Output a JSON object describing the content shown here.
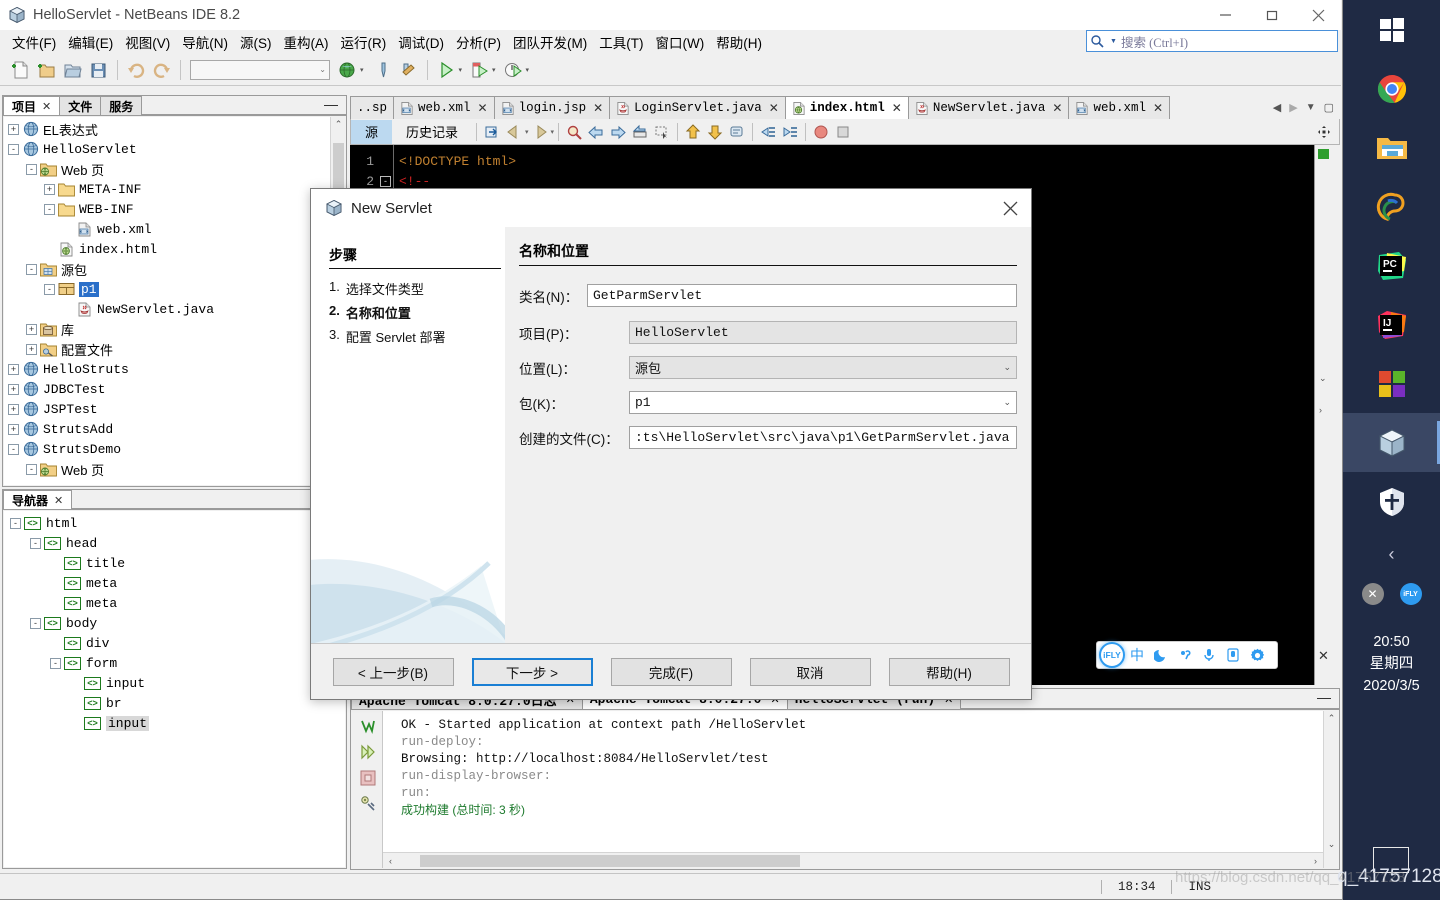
{
  "window": {
    "title": "HelloServlet - NetBeans IDE 8.2",
    "icon": "netbeans-cube-icon",
    "minimize": "minimize-icon",
    "maximize": "maximize-icon",
    "close": "close-icon"
  },
  "menubar": {
    "items": [
      "文件(F)",
      "编辑(E)",
      "视图(V)",
      "导航(N)",
      "源(S)",
      "重构(A)",
      "运行(R)",
      "调试(D)",
      "分析(P)",
      "团队开发(M)",
      "工具(T)",
      "窗口(W)",
      "帮助(H)"
    ]
  },
  "search": {
    "placeholder": "搜索 (Ctrl+I)",
    "value": "",
    "icon": "search-icon"
  },
  "toolbar": {
    "icons": [
      "new-file-icon",
      "new-project-icon",
      "open-project-icon",
      "save-all-icon",
      "undo-icon",
      "redo-icon"
    ],
    "combo_value": "",
    "run_icons": [
      "browser-icon",
      "build-icon",
      "clean-build-icon",
      "run-icon",
      "debug-icon",
      "profile-icon"
    ]
  },
  "left_panel": {
    "tabs": [
      {
        "label": "项目",
        "closable": true,
        "active": true
      },
      {
        "label": "文件",
        "closable": false,
        "active": false
      },
      {
        "label": "服务",
        "closable": false,
        "active": false
      }
    ],
    "minimize_label": "minimize-panel-icon",
    "tree": [
      {
        "indent": 0,
        "expander": "+",
        "icon": "project-globe-icon",
        "label": "EL表达式",
        "cjk": true,
        "selected": "none"
      },
      {
        "indent": 0,
        "expander": "-",
        "icon": "project-globe-icon",
        "label": "HelloServlet",
        "cjk": false,
        "selected": "none"
      },
      {
        "indent": 1,
        "expander": "-",
        "icon": "web-pages-icon",
        "label": "Web 页",
        "cjk": true,
        "selected": "none"
      },
      {
        "indent": 2,
        "expander": "+",
        "icon": "folder-icon",
        "label": "META-INF",
        "cjk": false,
        "selected": "none"
      },
      {
        "indent": 2,
        "expander": "-",
        "icon": "folder-icon",
        "label": "WEB-INF",
        "cjk": false,
        "selected": "none"
      },
      {
        "indent": 3,
        "expander": "",
        "icon": "xml-file-icon",
        "label": "web.xml",
        "cjk": false,
        "selected": "none"
      },
      {
        "indent": 2,
        "expander": "",
        "icon": "html-file-icon",
        "label": "index.html",
        "cjk": false,
        "selected": "none"
      },
      {
        "indent": 1,
        "expander": "-",
        "icon": "source-packages-icon",
        "label": "源包",
        "cjk": true,
        "selected": "none"
      },
      {
        "indent": 2,
        "expander": "-",
        "icon": "package-icon",
        "label": "p1",
        "cjk": false,
        "selected": "blue"
      },
      {
        "indent": 3,
        "expander": "",
        "icon": "java-file-icon",
        "label": "NewServlet.java",
        "cjk": false,
        "selected": "none"
      },
      {
        "indent": 1,
        "expander": "+",
        "icon": "libraries-icon",
        "label": "库",
        "cjk": true,
        "selected": "none"
      },
      {
        "indent": 1,
        "expander": "+",
        "icon": "config-files-icon",
        "label": "配置文件",
        "cjk": true,
        "selected": "none"
      },
      {
        "indent": 0,
        "expander": "+",
        "icon": "project-globe-icon",
        "label": "HelloStruts",
        "cjk": false,
        "selected": "none"
      },
      {
        "indent": 0,
        "expander": "+",
        "icon": "project-globe-icon",
        "label": "JDBCTest",
        "cjk": false,
        "selected": "none"
      },
      {
        "indent": 0,
        "expander": "+",
        "icon": "project-globe-icon",
        "label": "JSPTest",
        "cjk": false,
        "selected": "none"
      },
      {
        "indent": 0,
        "expander": "+",
        "icon": "project-globe-icon",
        "label": "StrutsAdd",
        "cjk": false,
        "selected": "none"
      },
      {
        "indent": 0,
        "expander": "-",
        "icon": "project-globe-icon",
        "label": "StrutsDemo",
        "cjk": false,
        "selected": "none"
      },
      {
        "indent": 1,
        "expander": "-",
        "icon": "web-pages-icon",
        "label": "Web 页",
        "cjk": true,
        "selected": "none"
      }
    ]
  },
  "navigator": {
    "tab_label": "导航器",
    "tree": [
      {
        "indent": 0,
        "expander": "-",
        "label": "html",
        "selected": false
      },
      {
        "indent": 1,
        "expander": "-",
        "label": "head",
        "selected": false
      },
      {
        "indent": 2,
        "expander": "",
        "label": "title",
        "selected": false
      },
      {
        "indent": 2,
        "expander": "",
        "label": "meta",
        "selected": false
      },
      {
        "indent": 2,
        "expander": "",
        "label": "meta",
        "selected": false
      },
      {
        "indent": 1,
        "expander": "-",
        "label": "body",
        "selected": false
      },
      {
        "indent": 2,
        "expander": "",
        "label": "div",
        "selected": false
      },
      {
        "indent": 2,
        "expander": "-",
        "label": "form",
        "selected": false
      },
      {
        "indent": 3,
        "expander": "",
        "label": "input",
        "selected": false
      },
      {
        "indent": 3,
        "expander": "",
        "label": "br",
        "selected": false
      },
      {
        "indent": 3,
        "expander": "",
        "label": "input",
        "selected": true
      }
    ]
  },
  "editor": {
    "tabs": [
      {
        "label": "..sp",
        "icon": "jsp-file-icon",
        "active": false,
        "closable": false,
        "truncated": true
      },
      {
        "label": "web.xml",
        "icon": "xml-file-icon",
        "active": false,
        "closable": true
      },
      {
        "label": "login.jsp",
        "icon": "jsp-file-icon",
        "active": false,
        "closable": true
      },
      {
        "label": "LoginServlet.java",
        "icon": "java-file-icon",
        "active": false,
        "closable": true
      },
      {
        "label": "index.html",
        "icon": "html-file-icon",
        "active": true,
        "closable": true
      },
      {
        "label": "NewServlet.java",
        "icon": "java-file-icon",
        "active": false,
        "closable": true
      },
      {
        "label": "web.xml",
        "icon": "xml-file-icon",
        "active": false,
        "closable": true
      }
    ],
    "tab_nav": [
      "scroll-left-icon",
      "scroll-right-icon",
      "tab-list-icon",
      "maximize-editor-icon"
    ],
    "toolbar": {
      "source_label": "源",
      "history_label": "历史记录",
      "icons": [
        "refresh-icon",
        "back-icon",
        "forward-icon",
        "find-icon",
        "prev-match-icon",
        "next-match-icon",
        "toggle-rect-icon",
        "select-rect-icon",
        "shift-up-icon",
        "shift-down-icon",
        "comment-icon",
        "shift-left-icon",
        "shift-right-icon",
        "record-macro-icon",
        "stop-macro-icon"
      ],
      "right_icon": "expand-all-icon"
    },
    "code_lines": [
      {
        "num": "1",
        "fold": "",
        "text": "<!DOCTYPE html>",
        "color": "#c08030"
      },
      {
        "num": "2",
        "fold": "-",
        "text": "<!--",
        "color": "#cc2222"
      }
    ]
  },
  "output": {
    "tabs": [
      {
        "label": "Apache Tomcat 8.0.27.0日志",
        "active": false,
        "closable": true
      },
      {
        "label": "Apache Tomcat 8.0.27.0",
        "active": true,
        "closable": true
      },
      {
        "label": "HelloServlet (run)",
        "active": false,
        "closable": true
      }
    ],
    "gutter_icons": [
      "rerun-icon",
      "run-again-icon",
      "stop-icon",
      "settings-icon"
    ],
    "lines": [
      {
        "text": "OK - Started application at context path /HelloServlet",
        "style": "ok"
      },
      {
        "text": "run-deploy:",
        "style": "dim"
      },
      {
        "text": "Browsing: http://localhost:8084/HelloServlet/test",
        "style": "ok"
      },
      {
        "text": "run-display-browser:",
        "style": "dim"
      },
      {
        "text": "run:",
        "style": "dim"
      },
      {
        "text": "成功构建 (总时间: 3 秒)",
        "style": "green"
      }
    ]
  },
  "statusbar": {
    "time": "18:34",
    "insert_mode": "INS"
  },
  "dialog": {
    "title": "New Servlet",
    "icon": "netbeans-cube-icon",
    "close_icon": "close-icon",
    "steps_heading": "步骤",
    "steps": [
      {
        "num": "1.",
        "label": "选择文件类型",
        "current": false
      },
      {
        "num": "2.",
        "label": "名称和位置",
        "current": true
      },
      {
        "num": "3.",
        "label": "配置 Servlet 部署",
        "current": false
      }
    ],
    "section_title": "名称和位置",
    "fields": [
      {
        "label": "类名(N)：",
        "value": "GetParmServlet",
        "type": "text",
        "readonly": false
      },
      {
        "label": "项目(P)：",
        "value": "HelloServlet",
        "type": "text",
        "readonly": true
      },
      {
        "label": "位置(L)：",
        "value": "源包",
        "type": "combo",
        "readonly": true
      },
      {
        "label": "包(K)：",
        "value": "p1",
        "type": "combo",
        "readonly": false
      },
      {
        "label": "创建的文件(C)：",
        "value": ":ts\\HelloServlet\\src\\java\\p1\\GetParmServlet.java",
        "type": "text",
        "readonly": false
      }
    ],
    "buttons": [
      {
        "label": "< 上一步(B)",
        "default": false
      },
      {
        "label": "下一步 >",
        "default": true
      },
      {
        "label": "完成(F)",
        "default": false
      },
      {
        "label": "取消",
        "default": false
      },
      {
        "label": "帮助(H)",
        "default": false
      }
    ]
  },
  "ime": {
    "logo": "iFLY",
    "buttons": [
      "chinese-mode-icon",
      "moon-icon",
      "punctuation-icon",
      "microphone-icon",
      "handwriting-icon",
      "settings-gear-icon"
    ],
    "labels": [
      "中",
      "moon",
      "punct",
      "mic",
      "pad",
      "gear"
    ],
    "close_icon": "close-icon"
  },
  "taskbar": {
    "items": [
      {
        "name": "windows-start-icon",
        "active": false
      },
      {
        "name": "chrome-icon",
        "active": false
      },
      {
        "name": "file-explorer-icon",
        "active": false
      },
      {
        "name": "tim-icon",
        "active": false
      },
      {
        "name": "pycharm-icon",
        "active": false
      },
      {
        "name": "intellij-idea-icon",
        "active": false
      },
      {
        "name": "microsoft-store-icon",
        "active": false
      },
      {
        "name": "netbeans-icon",
        "active": true
      },
      {
        "name": "windows-defender-icon",
        "active": false
      }
    ],
    "chevron": "show-hidden-icons-chevron",
    "tray": [
      "close-tray-icon",
      "ifly-tray-icon"
    ],
    "clock": {
      "time": "20:50",
      "weekday": "星期四",
      "date": "2020/3/5"
    },
    "show_desktop": "show-desktop-button"
  },
  "watermark": {
    "text": "https://blog.csdn.net/qq_41757128",
    "taskbar_text": "q_41757128"
  }
}
